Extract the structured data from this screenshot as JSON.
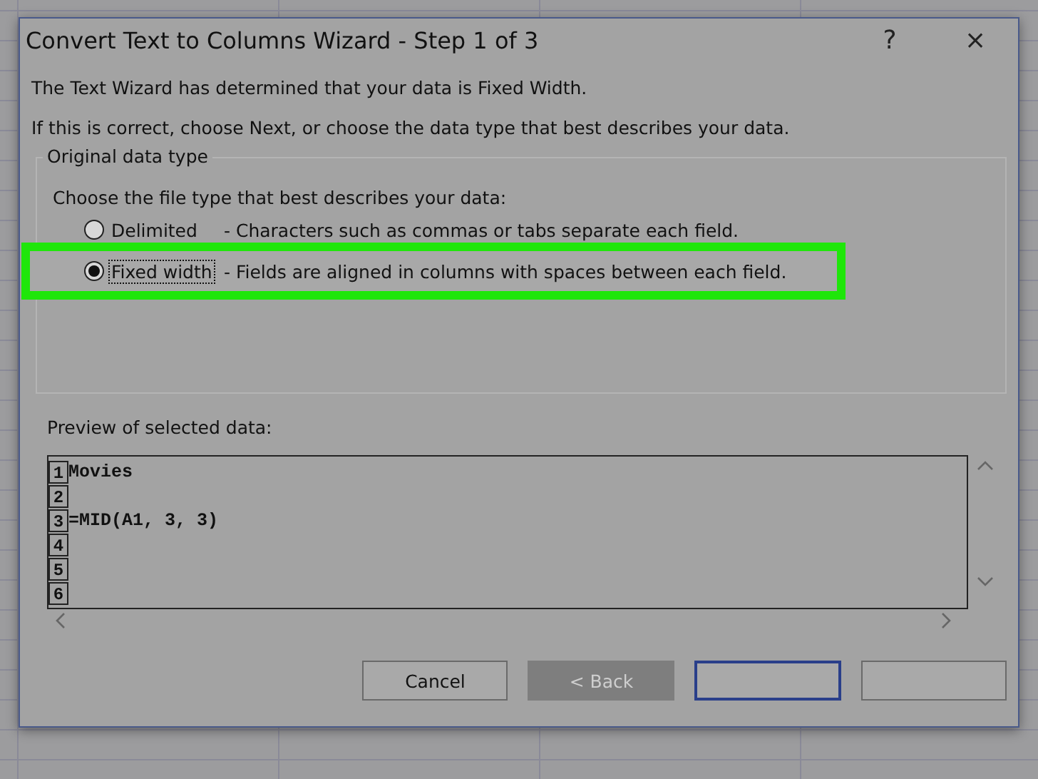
{
  "window": {
    "title": "Convert Text to Columns Wizard - Step 1 of 3",
    "controls": [
      "?",
      "×"
    ]
  },
  "intro": [
    "The Text Wizard has determined that your data is Fixed Width.",
    "If this is correct, choose Next, or choose the data type that best describes your data."
  ],
  "group": {
    "legend": "Original data type",
    "prompt": "Choose the file type that best describes your data:",
    "options": [
      {
        "label": "Delimited",
        "description": "- Characters such as commas or tabs separate each field.",
        "selected": false,
        "highlighted": false
      },
      {
        "label": "Fixed width",
        "description": "- Fields are aligned in columns with spaces between each field.",
        "selected": true,
        "highlighted": true
      }
    ]
  },
  "preview": {
    "label": "Preview of selected data:",
    "rows": [
      {
        "number": "1",
        "text": "Movies"
      },
      {
        "number": "2"
      },
      {
        "number": "3",
        "text": "=MID(A1, 3, 3)"
      },
      {
        "number": "4"
      },
      {
        "number": "5"
      },
      {
        "number": "6"
      }
    ]
  },
  "buttons": [
    {
      "label": "Cancel",
      "disabled": false
    },
    {
      "label": "< Back",
      "disabled": true
    },
    {
      "disabled": false,
      "focused": true
    },
    {
      "disabled": false,
      "focused": false
    }
  ]
}
